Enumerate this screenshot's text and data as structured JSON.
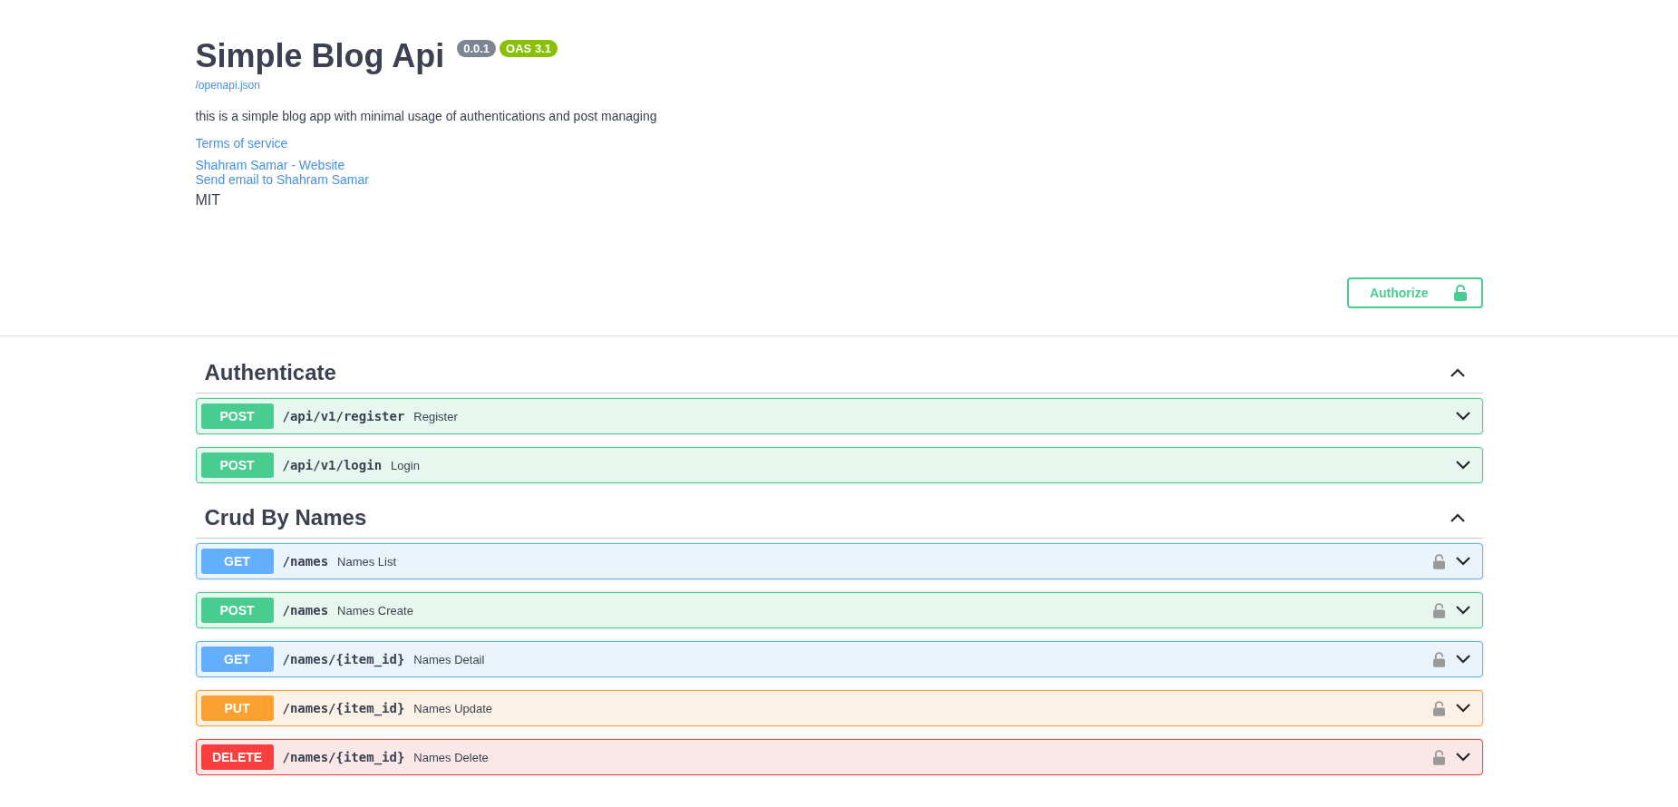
{
  "info": {
    "title": "Simple Blog Api",
    "version": "0.0.1",
    "oas": "OAS 3.1",
    "spec_link": "/openapi.json",
    "description": "this is a simple blog app with minimal usage of authentications and post managing",
    "terms": "Terms of service",
    "contact_website": "Shahram Samar - Website",
    "contact_email": "Send email to Shahram Samar",
    "license": "MIT"
  },
  "authorize": {
    "label": "Authorize"
  },
  "sections": [
    {
      "name": "Authenticate",
      "expanded": true,
      "operations": [
        {
          "method": "POST",
          "path": "/api/v1/register",
          "summary": "Register",
          "secured": false
        },
        {
          "method": "POST",
          "path": "/api/v1/login",
          "summary": "Login",
          "secured": false
        }
      ]
    },
    {
      "name": "Crud By Names",
      "expanded": true,
      "operations": [
        {
          "method": "GET",
          "path": "/names",
          "summary": "Names List",
          "secured": true
        },
        {
          "method": "POST",
          "path": "/names",
          "summary": "Names Create",
          "secured": true
        },
        {
          "method": "GET",
          "path": "/names/{item_id}",
          "summary": "Names Detail",
          "secured": true
        },
        {
          "method": "PUT",
          "path": "/names/{item_id}",
          "summary": "Names Update",
          "secured": true
        },
        {
          "method": "DELETE",
          "path": "/names/{item_id}",
          "summary": "Names Delete",
          "secured": true
        }
      ]
    }
  ]
}
